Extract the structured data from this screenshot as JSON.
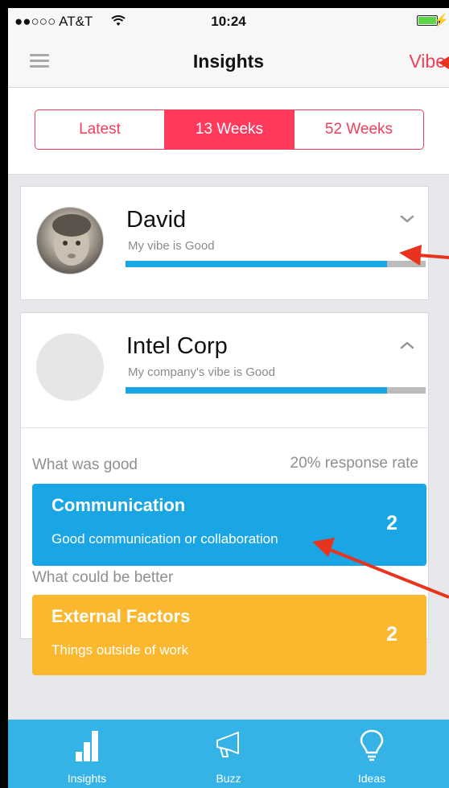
{
  "status_bar": {
    "carrier": "●●○○○ AT&T",
    "time": "10:24"
  },
  "nav": {
    "title": "Insights",
    "right_action": "Vibe"
  },
  "segments": [
    {
      "label": "Latest",
      "active": false
    },
    {
      "label": "13 Weeks",
      "active": true
    },
    {
      "label": "52 Weeks",
      "active": false
    }
  ],
  "person_card": {
    "name": "David",
    "subtitle": "My vibe is Good",
    "vibe_fraction": 0.87,
    "chevron": "chevron-down-icon"
  },
  "company_card": {
    "name": "Intel Corp",
    "subtitle": "My company's vibe is Good",
    "vibe_fraction": 0.87,
    "chevron": "chevron-up-icon",
    "good_label": "What was good",
    "response_rate": "20% response rate",
    "good_item": {
      "title": "Communication",
      "description": "Good communication or collaboration",
      "count": "2"
    },
    "better_label": "What could be better",
    "better_item": {
      "title": "External Factors",
      "description": "Things outside of work",
      "count": "2"
    }
  },
  "tabs": [
    {
      "label": "Insights",
      "icon": "bar-chart-icon"
    },
    {
      "label": "Buzz",
      "icon": "megaphone-icon"
    },
    {
      "label": "Ideas",
      "icon": "lightbulb-icon"
    }
  ],
  "colors": {
    "accent": "#ef3f5b",
    "blue": "#1aa6e4",
    "orange": "#fbb82e",
    "tabbar": "#35b3e6",
    "annotation": "#e8331e"
  }
}
